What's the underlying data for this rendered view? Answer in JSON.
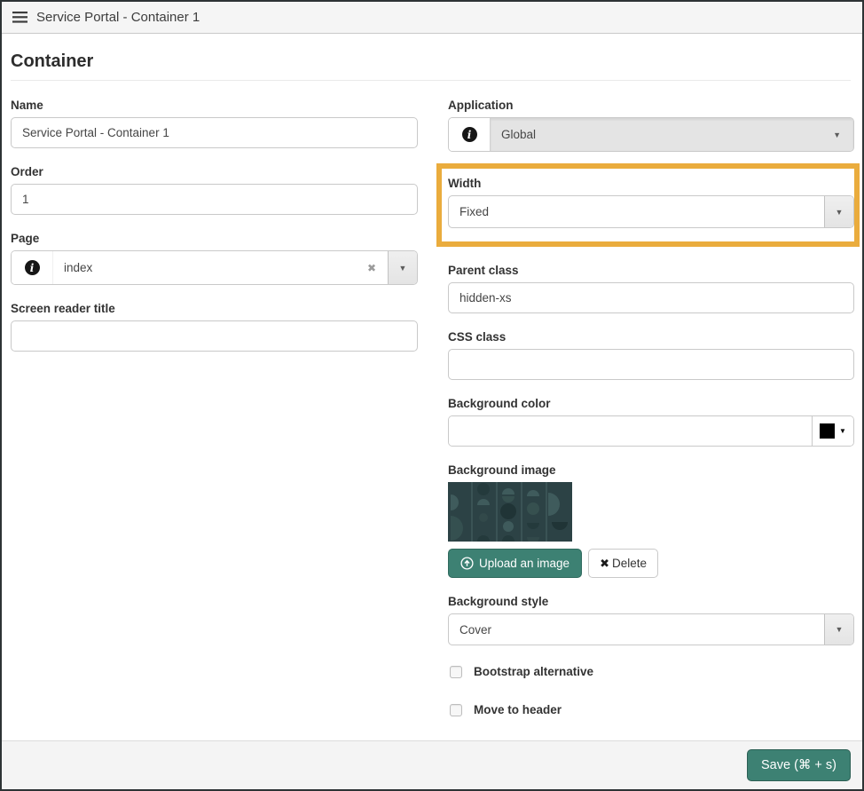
{
  "window": {
    "title": "Service Portal - Container 1"
  },
  "page": {
    "heading": "Container"
  },
  "fields": {
    "name": {
      "label": "Name",
      "value": "Service Portal - Container 1"
    },
    "order": {
      "label": "Order",
      "value": "1"
    },
    "page_ref": {
      "label": "Page",
      "value": "index"
    },
    "screen_reader_title": {
      "label": "Screen reader title",
      "value": ""
    },
    "application": {
      "label": "Application",
      "value": "Global",
      "disabled": true
    },
    "width": {
      "label": "Width",
      "value": "Fixed",
      "highlighted": true
    },
    "parent_class": {
      "label": "Parent class",
      "value": "hidden-xs"
    },
    "css_class": {
      "label": "CSS class",
      "value": ""
    },
    "background_color": {
      "label": "Background color",
      "value": "",
      "swatch_color": "#000000"
    },
    "background_image": {
      "label": "Background image"
    },
    "background_style": {
      "label": "Background style",
      "value": "Cover"
    },
    "bootstrap_alternative": {
      "label": "Bootstrap alternative",
      "checked": false
    },
    "move_to_header": {
      "label": "Move to header",
      "checked": false
    }
  },
  "buttons": {
    "upload_label": "Upload an image",
    "delete_label": "Delete",
    "save_label": "Save  (⌘ + s)"
  },
  "icons": {
    "menu": "hamburger-menu",
    "info": "i",
    "clear": "✖",
    "caret": "▼",
    "delete_x": "✖"
  },
  "colors": {
    "accent_teal": "#3d8173",
    "highlight_amber": "#eaac3d",
    "thumb_base": "#2c4245"
  }
}
